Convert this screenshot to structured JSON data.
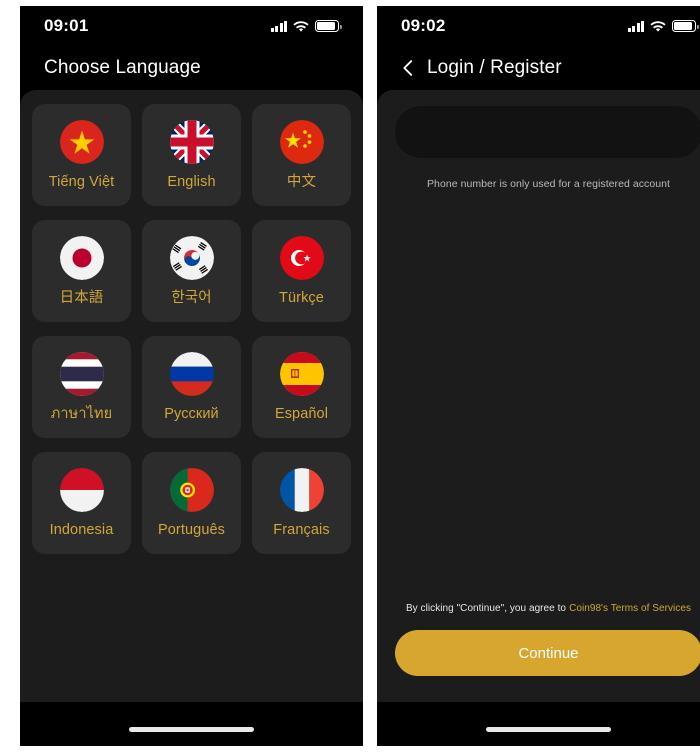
{
  "left_phone": {
    "status": {
      "time": "09:01",
      "signal_icon": "signal-bars-icon",
      "wifi_icon": "wifi-icon",
      "battery_icon": "battery-icon"
    },
    "title": "Choose Language",
    "languages": [
      {
        "label": "Tiếng Việt",
        "flag": "vn"
      },
      {
        "label": "English",
        "flag": "gb"
      },
      {
        "label": "中文",
        "flag": "cn"
      },
      {
        "label": "日本語",
        "flag": "jp"
      },
      {
        "label": "한국어",
        "flag": "kr"
      },
      {
        "label": "Türkçe",
        "flag": "tr"
      },
      {
        "label": "ภาษาไทย",
        "flag": "th"
      },
      {
        "label": "Русский",
        "flag": "ru"
      },
      {
        "label": "Español",
        "flag": "es"
      },
      {
        "label": "Indonesia",
        "flag": "id"
      },
      {
        "label": "Português",
        "flag": "pt"
      },
      {
        "label": "Français",
        "flag": "fr"
      }
    ]
  },
  "right_phone": {
    "status": {
      "time": "09:02",
      "signal_icon": "signal-bars-icon",
      "wifi_icon": "wifi-icon",
      "battery_icon": "battery-icon"
    },
    "back_icon": "chevron-left-icon",
    "title": "Login / Register",
    "phone_field": {
      "value": "",
      "placeholder": ""
    },
    "hint": "Phone number is only used for a registered account",
    "terms_prefix": "By clicking \"Continue\", you agree to",
    "terms_link": "Coin98's Terms of Services",
    "continue_label": "Continue"
  },
  "colors": {
    "accent_gold": "#d1a63c",
    "button_gold": "#d6a62e",
    "sheet_bg": "#1c1c1c",
    "card_bg": "#2c2c2c",
    "phone_bg": "#000000"
  }
}
